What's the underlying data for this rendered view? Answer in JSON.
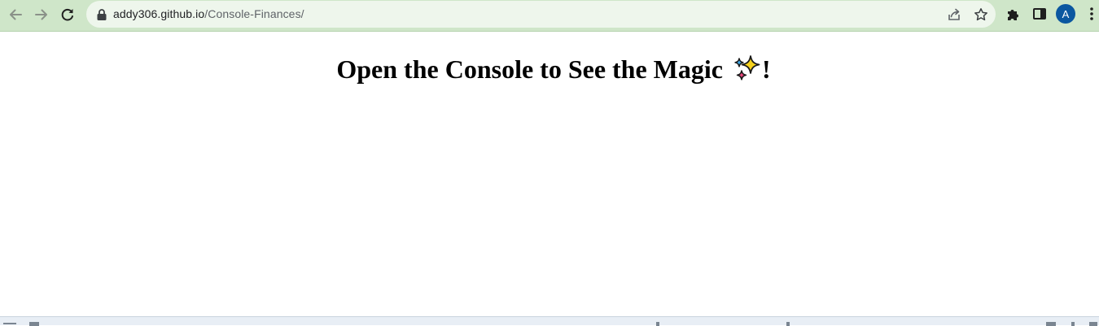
{
  "browser": {
    "url_domain": "addy306.github.io",
    "url_path": "/Console-Finances/",
    "profile_initial": "A",
    "icons": {
      "back": "back-arrow-icon",
      "forward": "forward-arrow-icon",
      "reload": "reload-icon",
      "lock": "lock-icon",
      "share": "share-icon",
      "bookmark": "star-icon",
      "extensions": "puzzle-piece-icon",
      "side_panel": "side-panel-icon",
      "menu": "kebab-menu-icon"
    },
    "colors": {
      "toolbar": "#cfe6c9",
      "omnibox": "#eef6ec",
      "avatar": "#0b57a0"
    }
  },
  "page": {
    "heading": "Open the Console to See the Magic",
    "heading_suffix": "!",
    "heading_emoji": "sparkles-icon"
  }
}
